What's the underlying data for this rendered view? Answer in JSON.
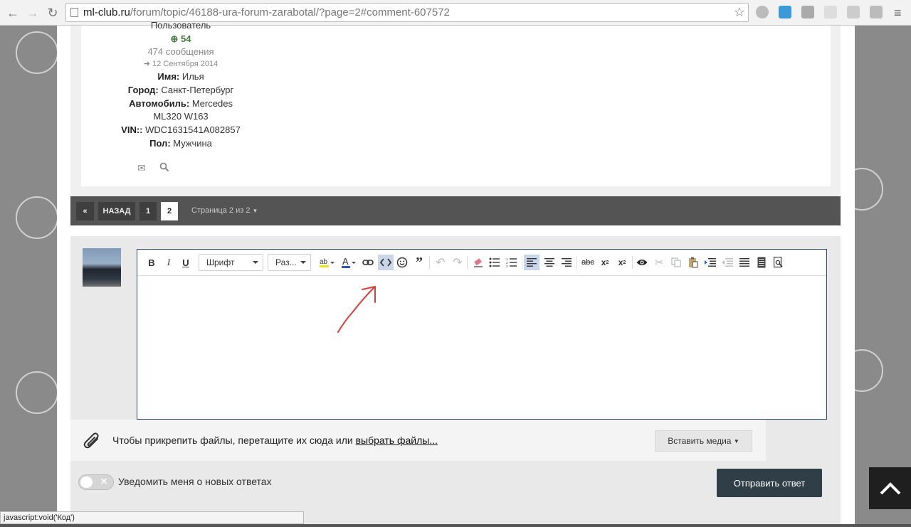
{
  "browser": {
    "url_host": "ml-club.ru",
    "url_rest": "/forum/topic/46188-ura-forum-zarabotal/?page=2#comment-607572",
    "status_text": "javascript:void('Код')"
  },
  "profile": {
    "role": "Пользователь",
    "reputation": "54",
    "posts": "474 сообщения",
    "joined": "12 Сентября 2014",
    "fields": [
      {
        "label": "Имя:",
        "value": "Илья"
      },
      {
        "label": "Город:",
        "value": "Санкт-Петербург"
      },
      {
        "label": "Автомобиль:",
        "value": "Mercedes"
      },
      {
        "label": "",
        "value": "ML320 W163"
      },
      {
        "label": "VIN::",
        "value": "WDC1631541A082857"
      },
      {
        "label": "Пол:",
        "value": "Мужчина"
      }
    ]
  },
  "pagination": {
    "back": "НАЗАД",
    "pages": [
      "1",
      "2"
    ],
    "current": "2",
    "info": "Страница 2 из 2"
  },
  "editor": {
    "font_select": "Шрифт",
    "size_select": "Раз...",
    "bold": "B",
    "italic": "I",
    "underline": "U"
  },
  "attach": {
    "prefix": "Чтобы прикрепить файлы, перетащите их сюда или ",
    "link": "выбрать файлы...",
    "insert_media": "Вставить медиа"
  },
  "notify_label": "Уведомить меня о новых ответах",
  "submit_label": "Отправить ответ",
  "colors": {
    "accent": "#2f3e47",
    "reputation": "#3f7a3a",
    "annotation_arrow": "#e53935"
  }
}
